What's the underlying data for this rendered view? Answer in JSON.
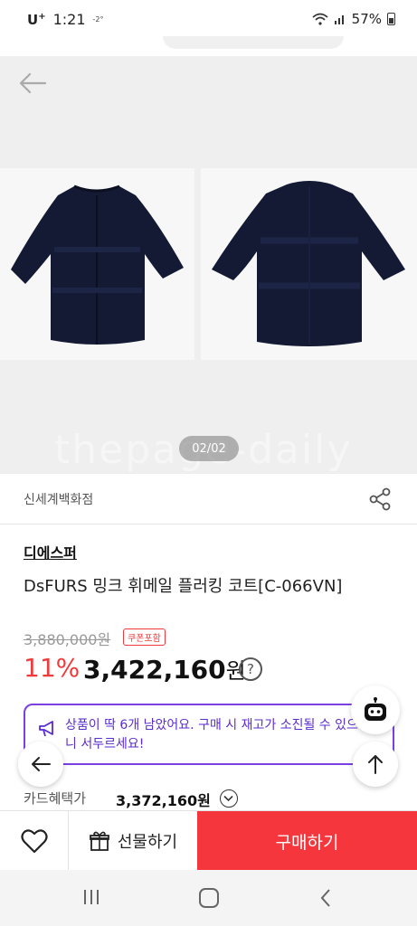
{
  "status_bar": {
    "carrier": "U",
    "carrier_sup": "+",
    "time": "1:21",
    "signal_small": "-2°",
    "battery": "57%"
  },
  "gallery": {
    "counter": "02/02",
    "watermark": "thepage-daily"
  },
  "store": {
    "name": "신세계백화점"
  },
  "product": {
    "brand": "디에스퍼",
    "name": "DsFURS 밍크 휘메일 플러킹 코트[C-066VN]",
    "original_price": "3,880,000원",
    "coupon_badge": "쿠폰포함",
    "discount": "11%",
    "price_number": "3,422,160",
    "price_unit": "원"
  },
  "stock_notice": "상품이 딱 6개 남았어요. 구매 시 재고가 소진될 수 있으니 서두르세요!",
  "card_benefit": {
    "label": "카드혜택가",
    "price": "3,372,160원"
  },
  "bottom_bar": {
    "gift_label": "선물하기",
    "buy_label": "구매하기"
  },
  "colors": {
    "accent_red": "#f5363c",
    "notice_purple": "#7b3fe4"
  }
}
